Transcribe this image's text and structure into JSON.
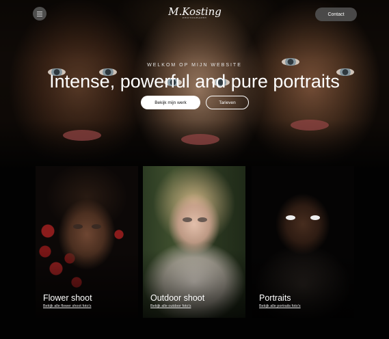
{
  "header": {
    "menu_icon": "hamburger-icon",
    "logo_text": "M.Kosting",
    "logo_subtext": "PHOTOGRAPHY",
    "contact_label": "Contact"
  },
  "hero": {
    "welcome": "WELKOM OP MIJN WEBSITE",
    "headline": "Intense, powerful and pure portraits",
    "primary_button": "Bekijk mijn werk",
    "secondary_button": "Tarieven"
  },
  "cards": [
    {
      "title": "Flower shoot",
      "link": "Bekijk alle flower shoot foto's"
    },
    {
      "title": "Outdoor shoot",
      "link": "Bekijk alle outdoor foto's"
    },
    {
      "title": "Portraits",
      "link": "Bekijk alle portraits foto's"
    }
  ]
}
